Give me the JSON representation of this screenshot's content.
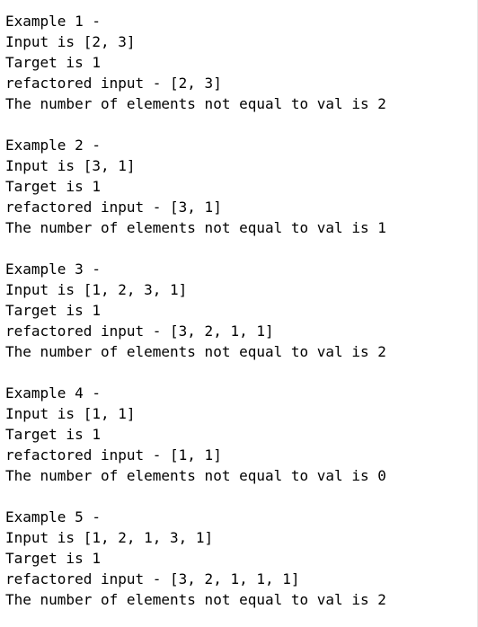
{
  "examples": [
    {
      "header": "Example 1 -",
      "input": "Input is [2, 3]",
      "target": "Target is 1",
      "refactored": "refactored input - [2, 3]",
      "result": "The number of elements not equal to val is 2"
    },
    {
      "header": "Example 2 -",
      "input": "Input is [3, 1]",
      "target": "Target is 1",
      "refactored": "refactored input - [3, 1]",
      "result": "The number of elements not equal to val is 1"
    },
    {
      "header": "Example 3 -",
      "input": "Input is [1, 2, 3, 1]",
      "target": "Target is 1",
      "refactored": "refactored input - [3, 2, 1, 1]",
      "result": "The number of elements not equal to val is 2"
    },
    {
      "header": "Example 4 -",
      "input": "Input is [1, 1]",
      "target": "Target is 1",
      "refactored": "refactored input - [1, 1]",
      "result": "The number of elements not equal to val is 0"
    },
    {
      "header": "Example 5 -",
      "input": "Input is [1, 2, 1, 3, 1]",
      "target": "Target is 1",
      "refactored": "refactored input - [3, 2, 1, 1, 1]",
      "result": "The number of elements not equal to val is 2"
    }
  ]
}
